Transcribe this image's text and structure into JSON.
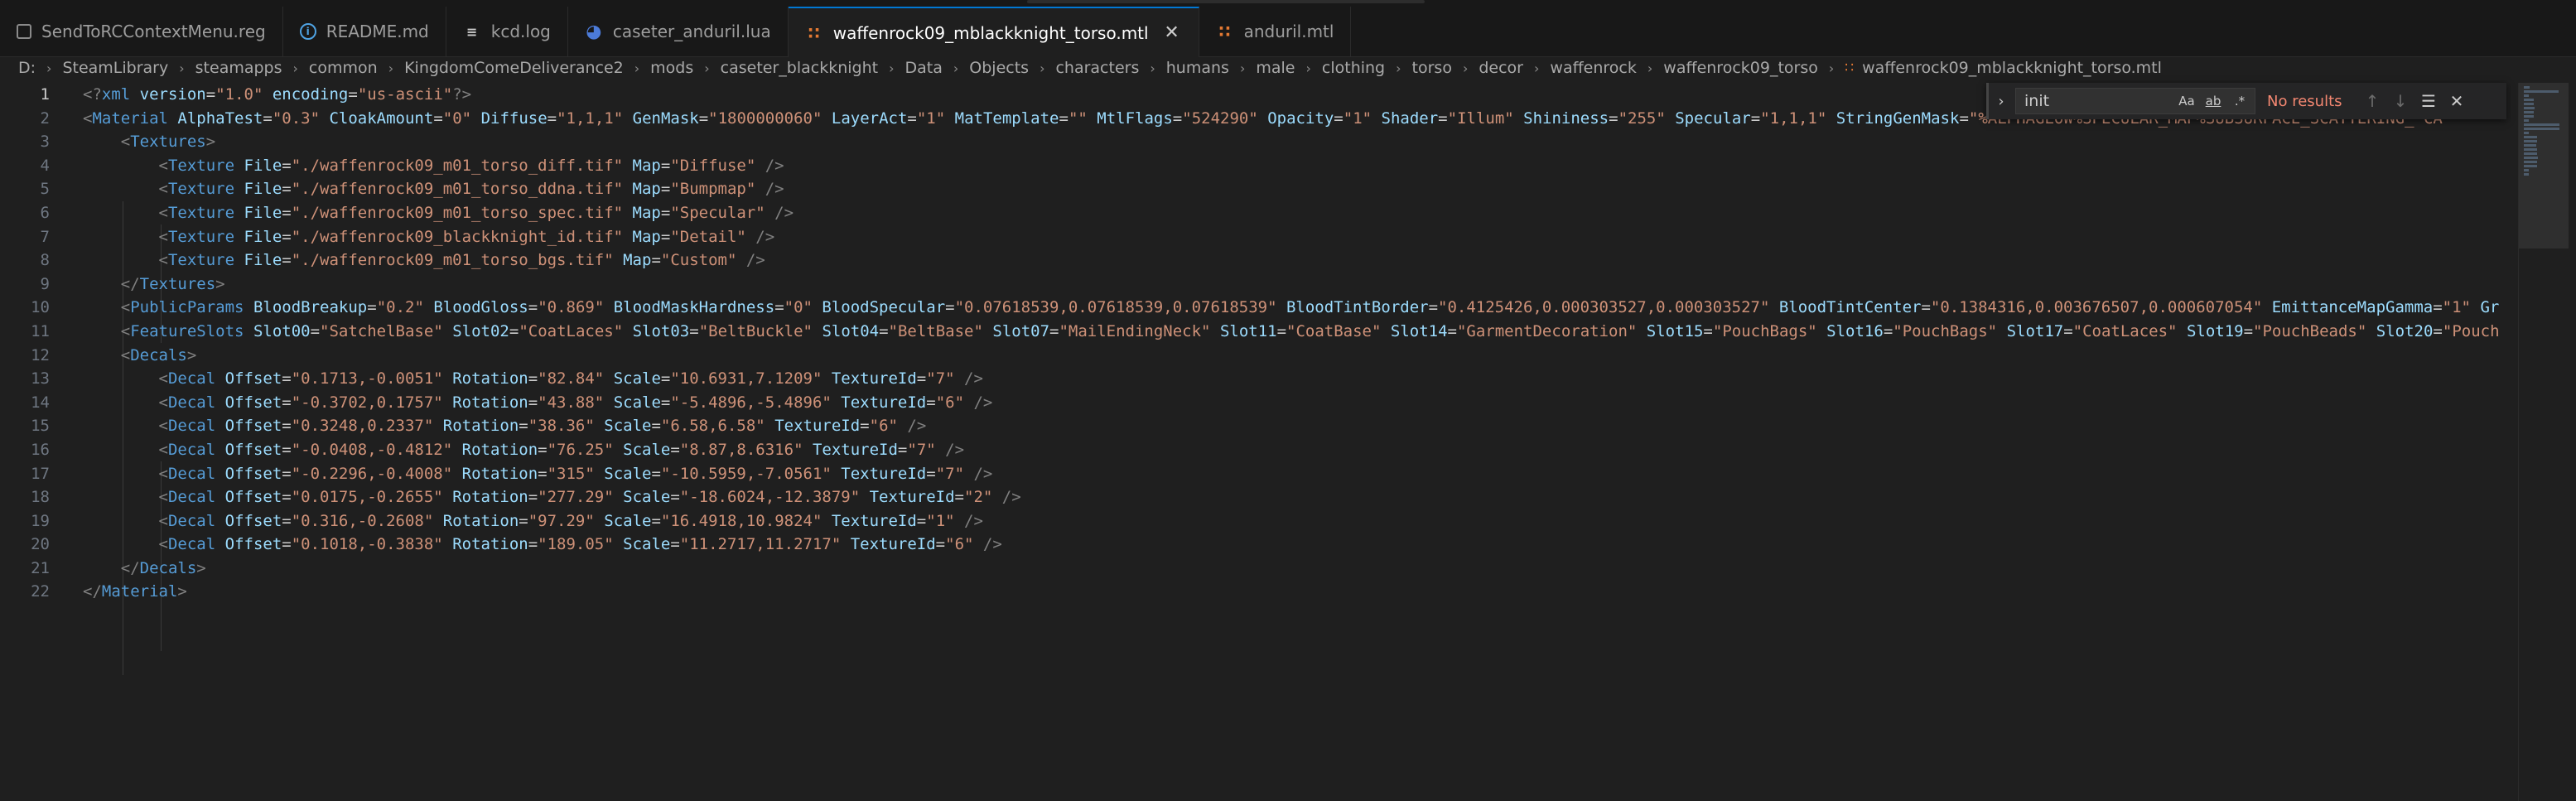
{
  "tabs": [
    {
      "label": "SendToRCContextMenu.reg",
      "icon": "registry-file-icon",
      "active": false
    },
    {
      "label": "README.md",
      "icon": "info-icon",
      "active": false
    },
    {
      "label": "kcd.log",
      "icon": "log-file-icon",
      "active": false
    },
    {
      "label": "caseter_anduril.lua",
      "icon": "lua-file-icon",
      "active": false
    },
    {
      "label": "waffenrock09_mblackknight_torso.mtl",
      "icon": "rss-file-icon",
      "active": true
    },
    {
      "label": "anduril.mtl",
      "icon": "rss-file-icon",
      "active": false
    }
  ],
  "tab_close_glyph": "✕",
  "breadcrumb": [
    "D:",
    "SteamLibrary",
    "steamapps",
    "common",
    "KingdomComeDeliverance2",
    "mods",
    "caseter_blackknight",
    "Data",
    "Objects",
    "characters",
    "humans",
    "male",
    "clothing",
    "torso",
    "decor",
    "waffenrock",
    "waffenrock09_torso",
    "waffenrock09_mblackknight_torso.mtl"
  ],
  "find": {
    "query": "init",
    "status": "No results",
    "options": [
      "Aa",
      "ab",
      ".*"
    ]
  },
  "editor": {
    "current_line": 1,
    "line_numbers": [
      "1",
      "2",
      "3",
      "4",
      "5",
      "6",
      "7",
      "8",
      "9",
      "10",
      "11",
      "12",
      "13",
      "14",
      "15",
      "16",
      "17",
      "18",
      "19",
      "20",
      "21",
      "22"
    ],
    "lines": [
      "<?xml version=\"1.0\" encoding=\"us-ascii\"?>",
      "<Material AlphaTest=\"0.3\" CloakAmount=\"0\" Diffuse=\"1,1,1\" GenMask=\"1800000060\" LayerAct=\"1\" MatTemplate=\"\" MtlFlags=\"524290\" Opacity=\"1\" Shader=\"Illum\" Shininess=\"255\" Specular=\"1,1,1\" StringGenMask=\"%ALPHAGLOW%SPECULAR_MAP%SUBSURFACE_SCATTERING_ CA",
      "    <Textures>",
      "        <Texture File=\"./waffenrock09_m01_torso_diff.tif\" Map=\"Diffuse\" />",
      "        <Texture File=\"./waffenrock09_m01_torso_ddna.tif\" Map=\"Bumpmap\" />",
      "        <Texture File=\"./waffenrock09_m01_torso_spec.tif\" Map=\"Specular\" />",
      "        <Texture File=\"./waffenrock09_blackknight_id.tif\" Map=\"Detail\" />",
      "        <Texture File=\"./waffenrock09_m01_torso_bgs.tif\" Map=\"Custom\" />",
      "    </Textures>",
      "    <PublicParams BloodBreakup=\"0.2\" BloodGloss=\"0.869\" BloodMaskHardness=\"0\" BloodSpecular=\"0.07618539,0.07618539,0.07618539\" BloodTintBorder=\"0.4125426,0.000303527,0.000303527\" BloodTintCenter=\"0.1384316,0.003676507,0.000607054\" EmittanceMapGamma=\"1\" Gr",
      "    <FeatureSlots Slot00=\"SatchelBase\" Slot02=\"CoatLaces\" Slot03=\"BeltBuckle\" Slot04=\"BeltBase\" Slot07=\"MailEndingNeck\" Slot11=\"CoatBase\" Slot14=\"GarmentDecoration\" Slot15=\"PouchBags\" Slot16=\"PouchBags\" Slot17=\"CoatLaces\" Slot19=\"PouchBeads\" Slot20=\"Pouch",
      "    <Decals>",
      "        <Decal Offset=\"0.1713,-0.0051\" Rotation=\"82.84\" Scale=\"10.6931,7.1209\" TextureId=\"7\" />",
      "        <Decal Offset=\"-0.3702,0.1757\" Rotation=\"43.88\" Scale=\"-5.4896,-5.4896\" TextureId=\"6\" />",
      "        <Decal Offset=\"0.3248,0.2337\" Rotation=\"38.36\" Scale=\"6.58,6.58\" TextureId=\"6\" />",
      "        <Decal Offset=\"-0.0408,-0.4812\" Rotation=\"76.25\" Scale=\"8.87,8.6316\" TextureId=\"7\" />",
      "        <Decal Offset=\"-0.2296,-0.4008\" Rotation=\"315\" Scale=\"-10.5959,-7.0561\" TextureId=\"7\" />",
      "        <Decal Offset=\"0.0175,-0.2655\" Rotation=\"277.29\" Scale=\"-18.6024,-12.3879\" TextureId=\"2\" />",
      "        <Decal Offset=\"0.316,-0.2608\" Rotation=\"97.29\" Scale=\"16.4918,10.9824\" TextureId=\"1\" />",
      "        <Decal Offset=\"0.1018,-0.3838\" Rotation=\"189.05\" Scale=\"11.2717,11.2717\" TextureId=\"6\" />",
      "    </Decals>",
      "</Material>"
    ]
  },
  "colors": {
    "tag": "#569cd6",
    "attribute": "#9cdcfe",
    "string": "#ce9178",
    "bracket": "#808080",
    "accent": "#0078d4",
    "error": "#f48771"
  }
}
